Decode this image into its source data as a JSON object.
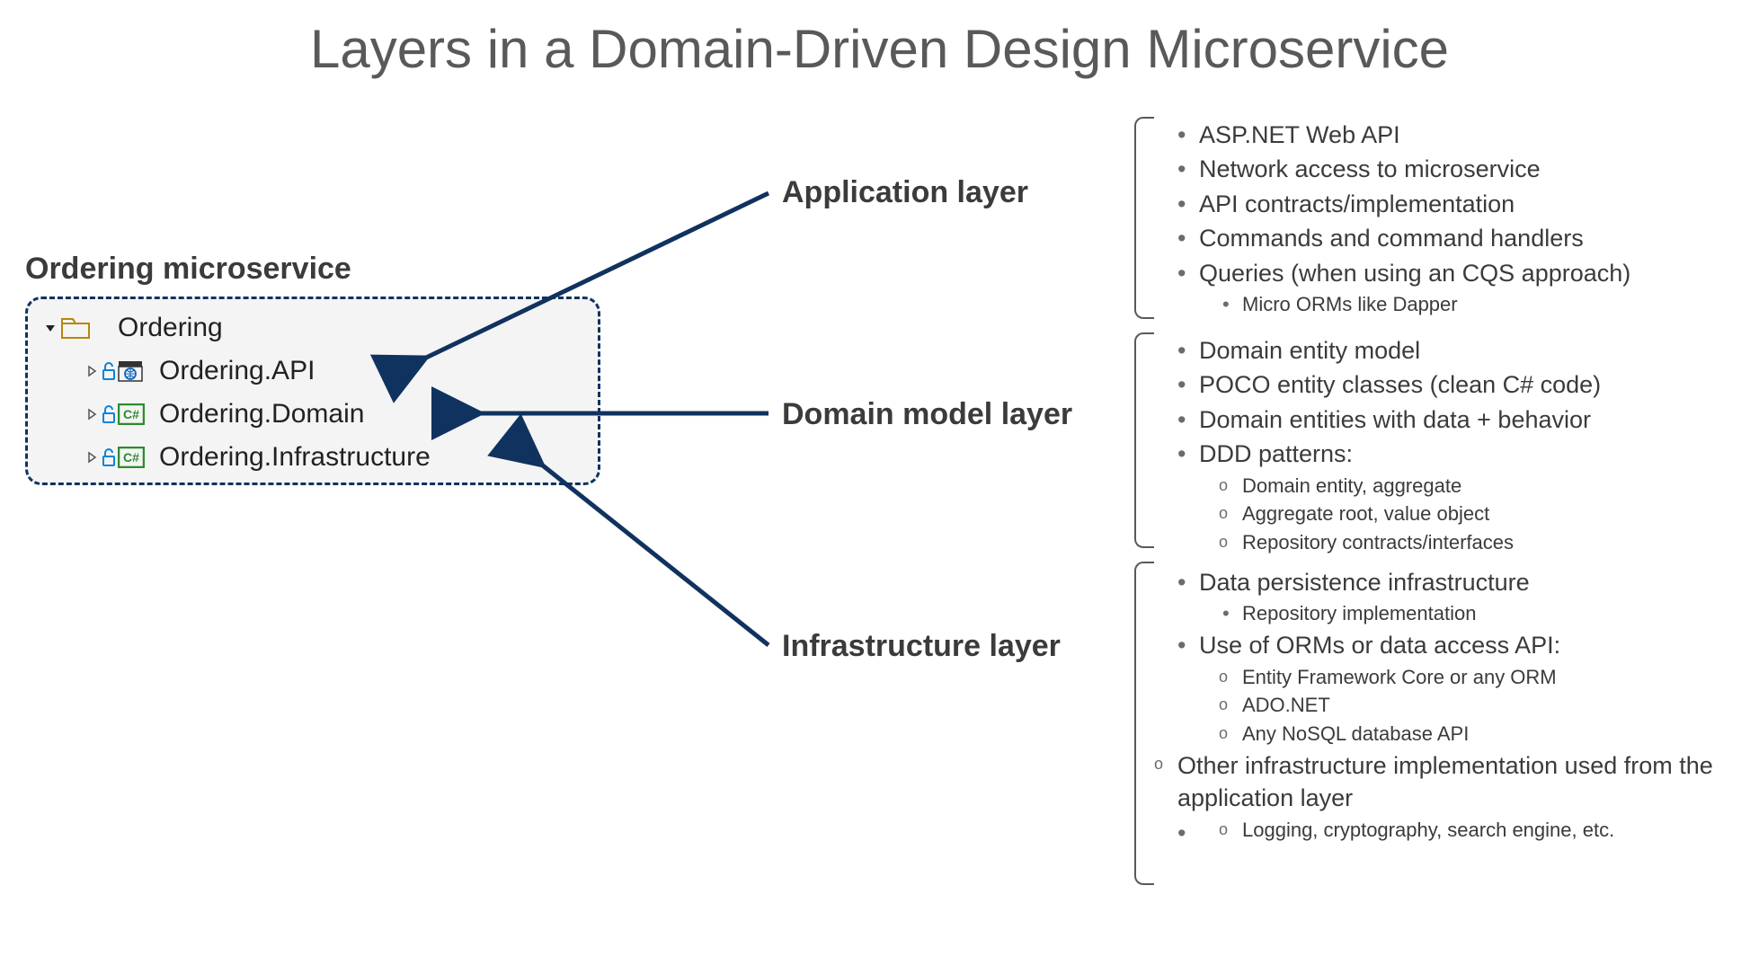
{
  "title": "Layers in a Domain-Driven Design Microservice",
  "microservice_label": "Ordering microservice",
  "vs_tree": {
    "root": "Ordering",
    "projects": [
      {
        "name": "Ordering.API",
        "icon": "web"
      },
      {
        "name": "Ordering.Domain",
        "icon": "csharp"
      },
      {
        "name": "Ordering.Infrastructure",
        "icon": "csharp"
      }
    ]
  },
  "layers": {
    "application": {
      "heading": "Application layer",
      "items": [
        "ASP.NET Web API",
        "Network access to microservice",
        "API contracts/implementation",
        "Commands and command handlers",
        "Queries (when using an CQS approach)"
      ],
      "sub_of_last": [
        "Micro ORMs like Dapper"
      ]
    },
    "domain": {
      "heading": "Domain model layer",
      "items": [
        "Domain entity model",
        "POCO entity classes (clean C# code)",
        "Domain entities with data + behavior",
        "DDD patterns:"
      ],
      "sub_of_last": [
        "Domain entity, aggregate",
        "Aggregate root, value object",
        "Repository contracts/interfaces"
      ]
    },
    "infrastructure": {
      "heading": "Infrastructure layer",
      "items_block1": [
        "Data persistence infrastructure"
      ],
      "sub_block1": [
        "Repository implementation"
      ],
      "items_block2": [
        "Use of ORMs or data access API:"
      ],
      "sub_block2": [
        "Entity Framework Core or any ORM",
        "ADO.NET",
        "Any NoSQL database API"
      ],
      "loose_item": "Other infrastructure implementation used from the application layer",
      "sub_block3": [
        "Logging, cryptography, search engine, etc."
      ]
    }
  }
}
